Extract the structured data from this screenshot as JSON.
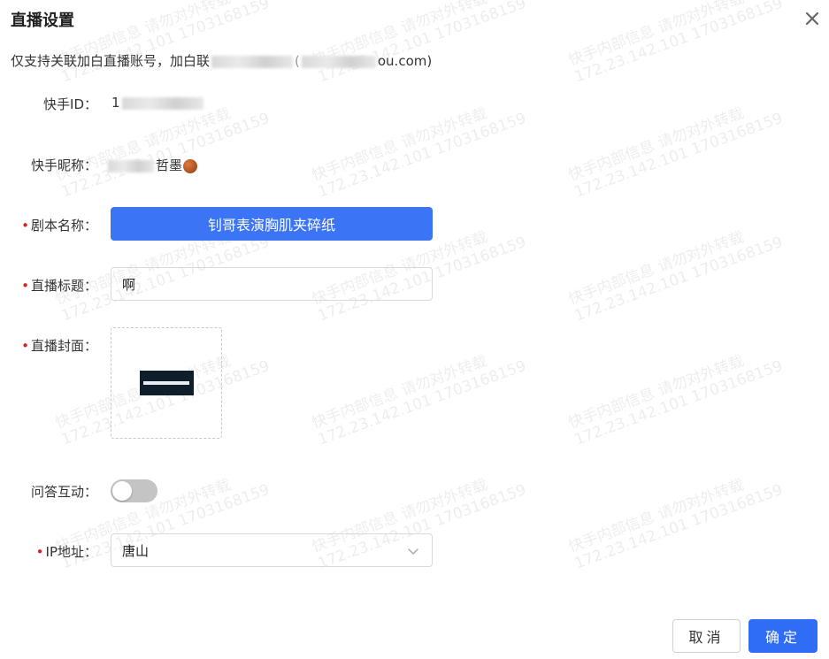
{
  "dialog": {
    "title": "直播设置"
  },
  "notice": {
    "prefix": "仅支持关联加白直播账号，加白联",
    "suffix": "ou.com)"
  },
  "fields": {
    "kuaishou_id": {
      "label": "快手ID：",
      "value_prefix": "1"
    },
    "nickname": {
      "label": "快手昵称：",
      "value_suffix": "哲墨"
    },
    "script_name": {
      "label": "剧本名称：",
      "value": "钊哥表演胸肌夹碎纸"
    },
    "live_title": {
      "label": "直播标题：",
      "value": "啊"
    },
    "live_cover": {
      "label": "直播封面："
    },
    "qa_interaction": {
      "label": "问答互动：",
      "enabled": false
    },
    "ip_location": {
      "label": "IP地址：",
      "value": "唐山"
    }
  },
  "required_mark": "•",
  "footer": {
    "cancel_label": "取消",
    "ok_label": "确定"
  },
  "watermark": {
    "line1": "快手内部信息 请勿对外转载",
    "line2": "172.23.142.101 1703168159"
  },
  "colors": {
    "primary": "#2f6df6",
    "script_button": "#3b74f5",
    "required": "#e02020"
  }
}
